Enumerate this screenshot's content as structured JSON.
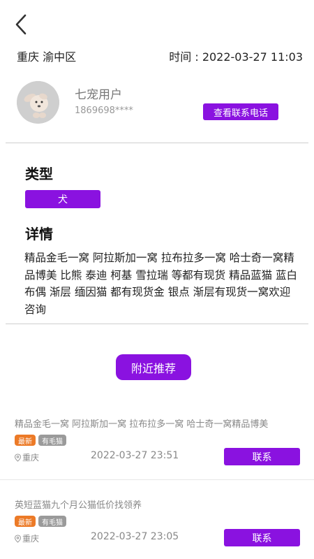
{
  "header": {
    "location": "重庆 渝中区",
    "time": "时间 : 2022-03-27 11:03"
  },
  "user": {
    "name": "七宠用户",
    "phone": "1869698****",
    "contact_phone_label": "查看联系电话"
  },
  "type_section": {
    "title": "类型",
    "value": "犬"
  },
  "detail_section": {
    "title": "详情",
    "text": "精品金毛一窝 阿拉斯加一窝 拉布拉多一窝 哈士奇一窝精品博美 比熊 泰迪 柯基 雪拉瑞 等都有现货 精品蓝猫 蓝白 布偶 渐层 缅因猫 都有现货金 银点 渐层有现货一窝欢迎咨询"
  },
  "nearby_label": "附近推荐",
  "listings": [
    {
      "title": "精品金毛一窝  阿拉斯加一窝   拉布拉多一窝   哈士奇一窝精品博美",
      "tags": [
        "最新",
        "有毛猫"
      ],
      "location": "重庆",
      "date": "2022-03-27 23:51",
      "contact_label": "联系"
    },
    {
      "title": "英短蓝猫九个月公猫低价找领养",
      "tags": [
        "最新",
        "有毛猫"
      ],
      "location": "重庆",
      "date": "2022-03-27 23:05",
      "contact_label": "联系"
    }
  ],
  "colors": {
    "accent": "#8a12e0",
    "tag_new": "#ec7a27",
    "tag_fur": "#9a9a9a"
  },
  "icons": {
    "back": "chevron-left-icon",
    "location": "location-pin-icon",
    "avatar": "dog-avatar-icon"
  }
}
